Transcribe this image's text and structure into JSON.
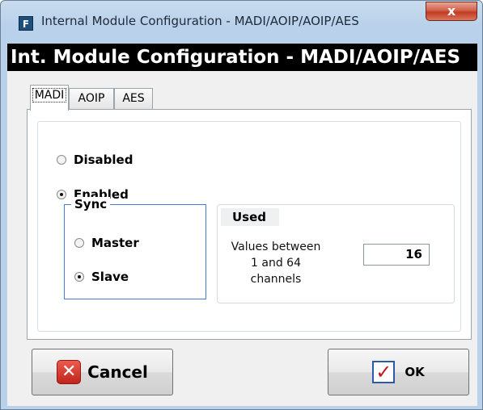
{
  "window": {
    "title": "Internal Module Configuration - MADI/AOIP/AOIP/AES",
    "close_label": "x",
    "app_icon_glyph": "F"
  },
  "header": {
    "title": "Int. Module Configuration - MADI/AOIP/AES"
  },
  "tabs": [
    {
      "label": "MADI",
      "active": true
    },
    {
      "label": "AOIP",
      "active": false
    },
    {
      "label": "AES",
      "active": false
    }
  ],
  "state": {
    "disabled_label": "Disabled",
    "enabled_label": "Enabled",
    "selected": "Enabled"
  },
  "sync": {
    "title": "Sync",
    "master_label": "Master",
    "slave_label": "Slave",
    "selected": "Slave"
  },
  "used": {
    "title": "Used",
    "desc_line1": "Values between",
    "desc_line2": "1 and 64",
    "desc_line3": "channels",
    "value": "16"
  },
  "buttons": {
    "cancel_label": "Cancel",
    "ok_label": "OK"
  },
  "colors": {
    "header_bg": "#000000",
    "window_frame": "#b9d1ea",
    "group_border": "#3b7fd4",
    "close_red": "#c23b22"
  },
  "icons": {
    "app": "app-logo-icon",
    "close": "close-icon",
    "cancel": "cancel-x-icon",
    "ok": "checkmark-icon"
  }
}
